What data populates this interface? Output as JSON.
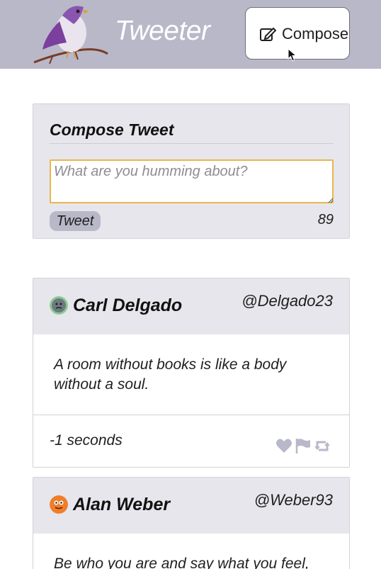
{
  "navbar": {
    "brand": "Tweeter",
    "compose_label": "Compose",
    "logo_icon": "bird-logo",
    "compose_icon": "edit-icon",
    "background": "#b8b8c8"
  },
  "compose": {
    "heading": "Compose Tweet",
    "placeholder": "What are you humming about?",
    "value": "",
    "submit_label": "Tweet",
    "char_count": "89",
    "focus_border": "#e9b64d"
  },
  "tweets": [
    {
      "name": "Carl Delgado",
      "handle": "@Delgado23",
      "content": "A room without books is like a body without a soul.",
      "time": "-1 seconds",
      "avatar_color": "#7b8a8f"
    },
    {
      "name": "Alan Weber",
      "handle": "@Weber93",
      "content": "Be who you are and say what you feel, be-",
      "avatar_color": "#f07d2a"
    }
  ],
  "actions": {
    "like_icon": "heart-icon",
    "flag_icon": "flag-icon",
    "retweet_icon": "retweet-icon",
    "icon_color": "#b8b8c8"
  }
}
